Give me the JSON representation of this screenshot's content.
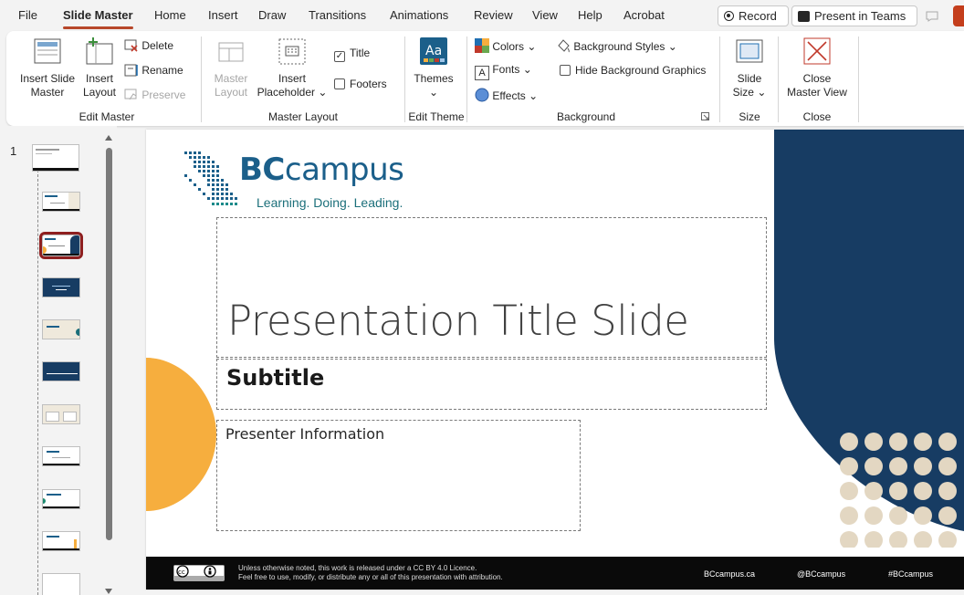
{
  "tabs": {
    "file": "File",
    "slide_master": "Slide Master",
    "home": "Home",
    "insert": "Insert",
    "draw": "Draw",
    "transitions": "Transitions",
    "animations": "Animations",
    "review": "Review",
    "view": "View",
    "help": "Help",
    "acrobat": "Acrobat"
  },
  "actions": {
    "record": "Record",
    "present_in_teams": "Present in Teams"
  },
  "ribbon": {
    "edit_master": {
      "insert_slide_master_1": "Insert Slide",
      "insert_slide_master_2": "Master",
      "insert_layout_1": "Insert",
      "insert_layout_2": "Layout",
      "delete": "Delete",
      "rename": "Rename",
      "preserve": "Preserve",
      "label": "Edit Master"
    },
    "master_layout": {
      "master_layout_1": "Master",
      "master_layout_2": "Layout",
      "insert_placeholder_1": "Insert",
      "insert_placeholder_2": "Placeholder",
      "title": "Title",
      "footers": "Footers",
      "label": "Master Layout"
    },
    "edit_theme": {
      "themes": "Themes",
      "label": "Edit Theme"
    },
    "background": {
      "colors": "Colors",
      "fonts": "Fonts",
      "effects": "Effects",
      "background_styles": "Background Styles",
      "hide_background_graphics": "Hide Background Graphics",
      "label": "Background"
    },
    "size": {
      "slide_size_1": "Slide",
      "slide_size_2": "Size",
      "label": "Size"
    },
    "close": {
      "close_master_view_1": "Close",
      "close_master_view_2": "Master View",
      "label": "Close"
    }
  },
  "thumbnails": {
    "master_number": "1",
    "count": 11,
    "selected_index": 2
  },
  "slide": {
    "logo_bold": "BC",
    "logo_rest": "campus",
    "logo_tagline": "Learning. Doing. Leading.",
    "title": "Presentation Title Slide",
    "subtitle": "Subtitle",
    "presenter": "Presenter Information",
    "footer_line1": "Unless otherwise noted, this work is released under a CC BY 4.0 Licence.",
    "footer_line2": "Feel free to use, modify, or distribute any or all of this presentation with attribution.",
    "footer_site": "BCcampus.ca",
    "footer_handle": "@BCcampus",
    "footer_hashtag": "#BCcampus"
  },
  "colors": {
    "accent_tab": "#b7472a",
    "navy": "#173c63",
    "orange": "#f6ae3e",
    "beige_dots": "#e3d7c2",
    "selected_thumb": "#8e1f1f"
  }
}
